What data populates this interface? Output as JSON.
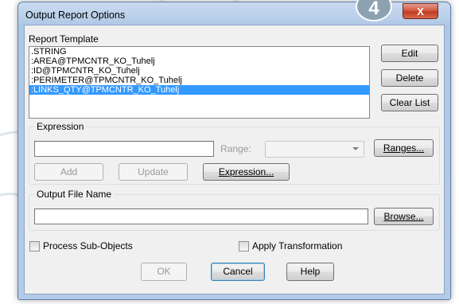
{
  "window": {
    "title": "Output Report Options",
    "close_glyph": "X",
    "step_badge": "4"
  },
  "report_template": {
    "label": "Report Template",
    "items": [
      ".STRING",
      ":AREA@TPMCNTR_KO_Tuhelj",
      ":ID@TPMCNTR_KO_Tuhelj",
      ":PERIMETER@TPMCNTR_KO_Tuhelj",
      ":LINKS_QTY@TPMCNTR_KO_Tuhelj"
    ],
    "selected_index": 4
  },
  "side_buttons": {
    "edit": "Edit",
    "delete": "Delete",
    "clear_list": "Clear List"
  },
  "expression": {
    "group_label": "Expression",
    "input_value": "",
    "range_label": "Range:",
    "range_value": "",
    "ranges_button": "Ranges...",
    "add_button": "Add",
    "update_button": "Update",
    "expression_button": "Expression..."
  },
  "output_file": {
    "group_label": "Output File Name",
    "input_value": "",
    "browse_button": "Browse..."
  },
  "options": {
    "process_sub_objects": {
      "label": "Process Sub-Objects",
      "checked": false
    },
    "apply_transformation": {
      "label": "Apply Transformation",
      "checked": false
    }
  },
  "footer": {
    "ok": "OK",
    "cancel": "Cancel",
    "help": "Help"
  },
  "colors": {
    "selection": "#3399ff",
    "titlebar": "#b9cfe9",
    "close_button": "#c03a20",
    "badge": "#8da2b1"
  }
}
